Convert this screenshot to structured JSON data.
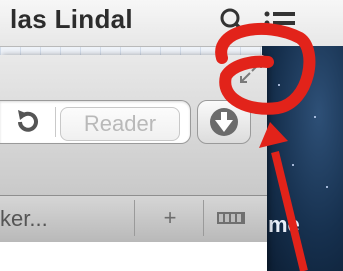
{
  "menubar": {
    "user_name": "las Lindal",
    "spotlight_icon": "magnifier-icon",
    "list_icon": "list-icon"
  },
  "toolbar": {
    "fullscreen_icon": "fullscreen-arrows-icon",
    "reload_icon": "reload-icon",
    "reader_label": "Reader",
    "download_icon": "download-arrow-icon"
  },
  "tabs": {
    "tab_label": "ker...",
    "new_tab_label": "+",
    "overview_icon": "tab-overview-icon"
  },
  "desktop": {
    "partial_text": "me"
  },
  "annotation": {
    "color": "#e2231a",
    "shape": "circle-and-arrow"
  }
}
